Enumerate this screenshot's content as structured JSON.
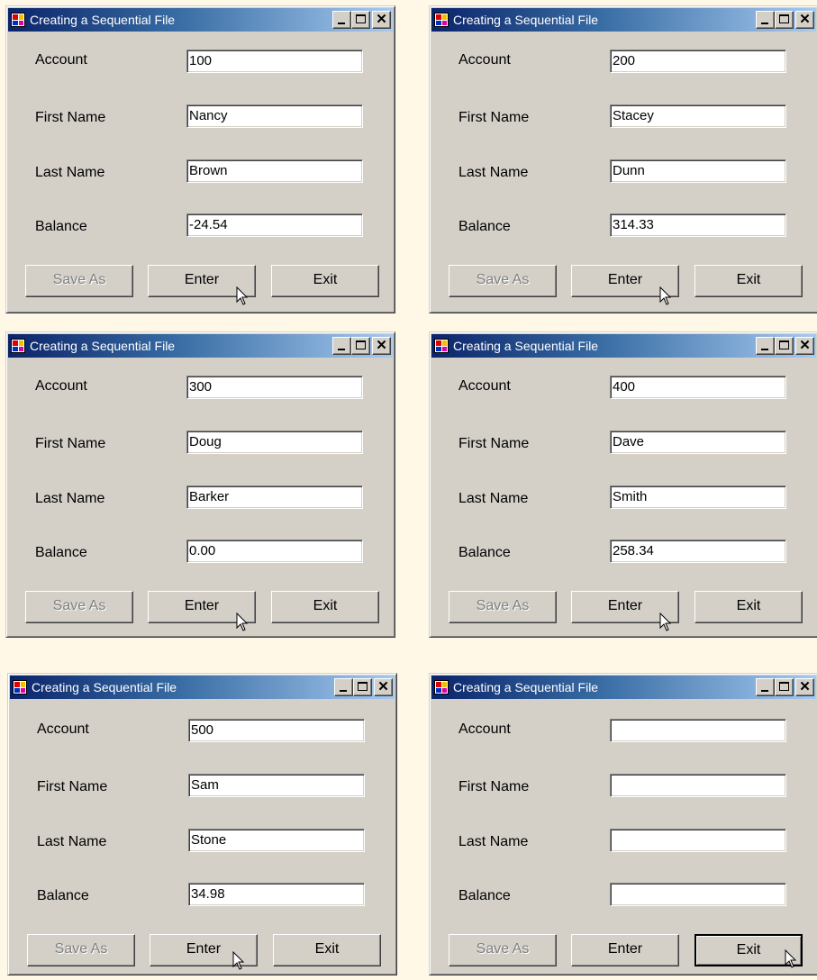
{
  "labels": {
    "account": "Account",
    "first_name": "First Name",
    "last_name": "Last Name",
    "balance": "Balance"
  },
  "buttons": {
    "save_as": "Save As",
    "enter": "Enter",
    "exit": "Exit"
  },
  "window_title": "Creating a Sequential File",
  "windows": [
    {
      "account": "100",
      "first_name": "Nancy",
      "last_name": "Brown",
      "balance": "-24.54",
      "save_as_enabled": false,
      "hovered_button": "enter"
    },
    {
      "account": "200",
      "first_name": "Stacey",
      "last_name": "Dunn",
      "balance": "314.33",
      "save_as_enabled": false,
      "hovered_button": "enter"
    },
    {
      "account": "300",
      "first_name": "Doug",
      "last_name": "Barker",
      "balance": "0.00",
      "save_as_enabled": false,
      "hovered_button": "enter"
    },
    {
      "account": "400",
      "first_name": "Dave",
      "last_name": "Smith",
      "balance": "258.34",
      "save_as_enabled": false,
      "hovered_button": "enter"
    },
    {
      "account": "500",
      "first_name": "Sam",
      "last_name": "Stone",
      "balance": "34.98",
      "save_as_enabled": false,
      "hovered_button": "enter"
    },
    {
      "account": "",
      "first_name": "",
      "last_name": "",
      "balance": "",
      "save_as_enabled": false,
      "hovered_button": "exit"
    }
  ],
  "colors": {
    "page_background": "#FFF8E7",
    "window_face": "#D4D0C8",
    "title_gradient_start": "#0A246A",
    "title_gradient_end": "#A6CAF0",
    "disabled_text": "#808080"
  },
  "icons": {
    "app": "app-icon",
    "minimize": "minimize-icon",
    "maximize": "maximize-icon",
    "close": "close-icon",
    "cursor": "mouse-pointer-icon"
  }
}
